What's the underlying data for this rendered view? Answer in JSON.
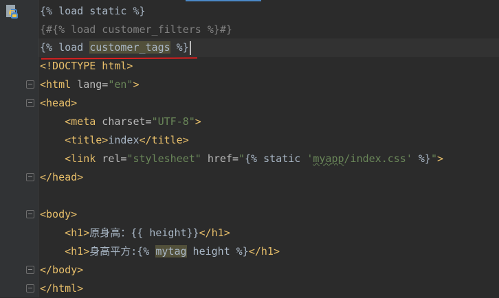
{
  "editor": {
    "lines": [
      {
        "parts": [
          "{% ",
          "load",
          " static ",
          "%}"
        ]
      },
      {
        "parts": [
          "{#{% load customer_filters %}#}"
        ]
      },
      {
        "parts": [
          "{% ",
          "load",
          " ",
          "customer_tags",
          " %}"
        ]
      },
      {
        "parts": [
          "<!DOCTYPE html>"
        ]
      },
      {
        "parts": [
          "<html",
          " lang=",
          "\"en\"",
          ">"
        ]
      },
      {
        "parts": [
          "<head>"
        ]
      },
      {
        "parts": [
          "    ",
          "<meta",
          " charset=",
          "\"UTF-8\"",
          ">"
        ]
      },
      {
        "parts": [
          "    ",
          "<title>",
          "index",
          "</title>"
        ]
      },
      {
        "parts": [
          "    ",
          "<link",
          " rel=",
          "\"stylesheet\"",
          " href=",
          "\"",
          "{% ",
          "static ",
          "'",
          "myapp",
          "/index.css'",
          " %}",
          "\"",
          ">"
        ]
      },
      {
        "parts": [
          "</head>"
        ]
      },
      {
        "parts": [
          ""
        ]
      },
      {
        "parts": [
          "<body>"
        ]
      },
      {
        "parts": [
          "    ",
          "<h1>",
          "原身高：{{ height}}",
          "</h1>"
        ]
      },
      {
        "parts": [
          "    ",
          "<h1>",
          "身高平方:",
          "{% ",
          "mytag",
          " height ",
          "%}",
          "</h1>"
        ]
      },
      {
        "parts": [
          "</body>"
        ]
      },
      {
        "parts": [
          "</html>"
        ]
      }
    ]
  },
  "colors": {
    "background": "#2b2b2b",
    "gutter": "#313335",
    "tag": "#e8bf6a",
    "string": "#6a8759",
    "comment": "#808080",
    "highlight": "#52503a",
    "annotation_underline": "#e02020"
  },
  "icons": {
    "file_type": "python-file-icon",
    "fold_marker": "fold-marker-icon"
  }
}
